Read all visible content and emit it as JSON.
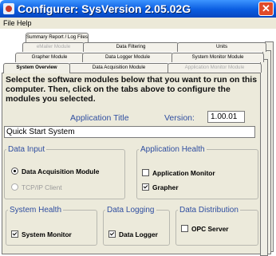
{
  "window": {
    "title": "Configurer:  SysVersion 2.05.02G",
    "close_glyph": "✕"
  },
  "menu": [
    "File",
    "Help"
  ],
  "tabs": {
    "row1": [
      "Summary Report / Log Files"
    ],
    "row2": [
      "eMailer Module",
      "Data Filtering",
      "Units"
    ],
    "row3": [
      "Grapher Module",
      "Data Logger Module",
      "System Monitor Module"
    ],
    "row4": [
      "System Overview",
      "Data Acquisition Module",
      "Application Monitor Module"
    ]
  },
  "panel": {
    "instructions": "Select the software modules below that you want to run on this computer.  Then, click on the tabs above to configure the modules you selected.",
    "app_title_label": "Application Title",
    "version_label": "Version:",
    "version_value": "1.00.01",
    "title_value": "Quick Start System"
  },
  "groups": {
    "data_input": {
      "legend": "Data Input",
      "options": [
        {
          "label": "Data Acquisition Module",
          "checked": true,
          "enabled": true
        },
        {
          "label": "TCP/IP Client",
          "checked": false,
          "enabled": false
        }
      ]
    },
    "app_health": {
      "legend": "Application Health",
      "options": [
        {
          "label": "Application Monitor",
          "checked": false
        },
        {
          "label": "Grapher",
          "checked": true
        }
      ]
    },
    "system_health": {
      "legend": "System Health",
      "options": [
        {
          "label": "System Monitor",
          "checked": true
        }
      ]
    },
    "data_logging": {
      "legend": "Data Logging",
      "options": [
        {
          "label": "Data Logger",
          "checked": true
        }
      ]
    },
    "data_distribution": {
      "legend": "Data Distribution",
      "options": [
        {
          "label": "OPC Server",
          "checked": false
        }
      ]
    }
  },
  "colors": {
    "titlebar": "#0a5ce0",
    "panel_bg": "#eceadb",
    "label_blue": "#2f4ea0"
  }
}
